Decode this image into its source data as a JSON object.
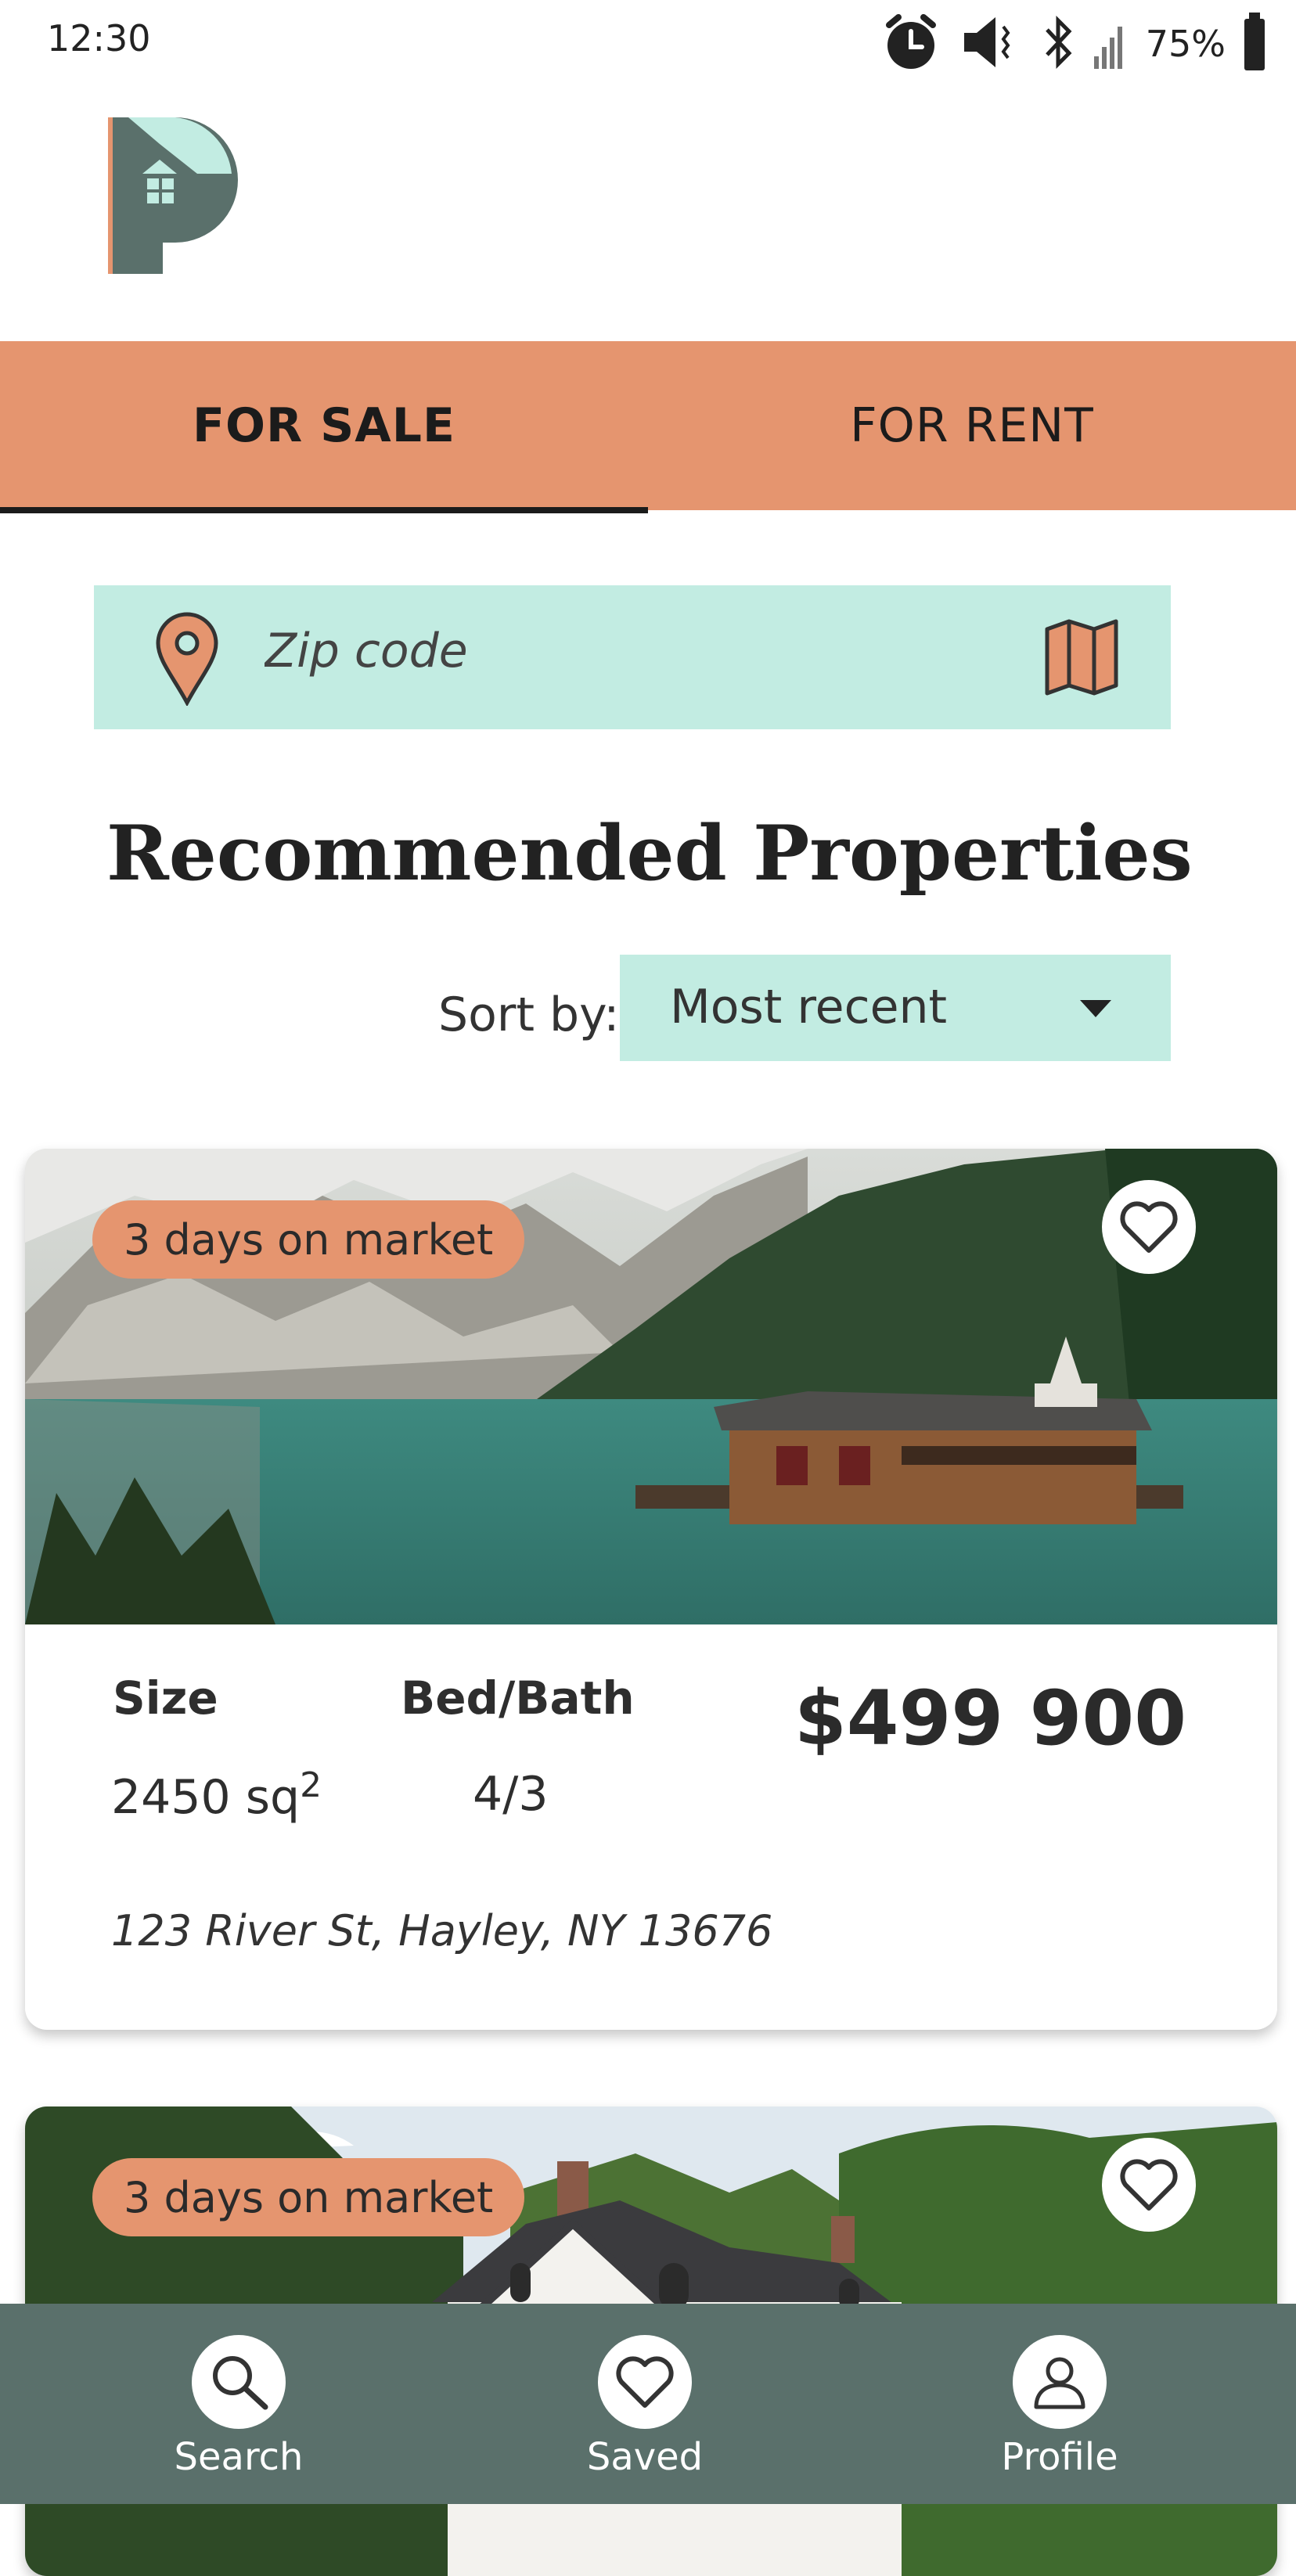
{
  "status_bar": {
    "time": "12:30",
    "battery": "75%"
  },
  "tabs": [
    {
      "label": "FOR SALE",
      "active": true
    },
    {
      "label": "FOR RENT",
      "active": false
    }
  ],
  "search": {
    "placeholder": "Zip code"
  },
  "section": {
    "title": "Recommended Properties"
  },
  "sort": {
    "label": "Sort by:",
    "value": "Most recent"
  },
  "listings": [
    {
      "badge": "3 days on market",
      "size_label": "Size",
      "size_value": "2450 sq",
      "size_sup": "2",
      "bedbath_label": "Bed/Bath",
      "bedbath_value": "4/3",
      "price": "$499 900",
      "address": "123 River St, Hayley, NY 13676"
    },
    {
      "badge": "3 days on market"
    }
  ],
  "bottom_nav": [
    {
      "label": "Search",
      "icon": "search-icon"
    },
    {
      "label": "Saved",
      "icon": "heart-icon"
    },
    {
      "label": "Profile",
      "icon": "profile-icon"
    }
  ],
  "colors": {
    "accent": "#E5956F",
    "mint": "#C2ECE2",
    "nav": "#5A706B",
    "logo_dark": "#5A706B"
  }
}
